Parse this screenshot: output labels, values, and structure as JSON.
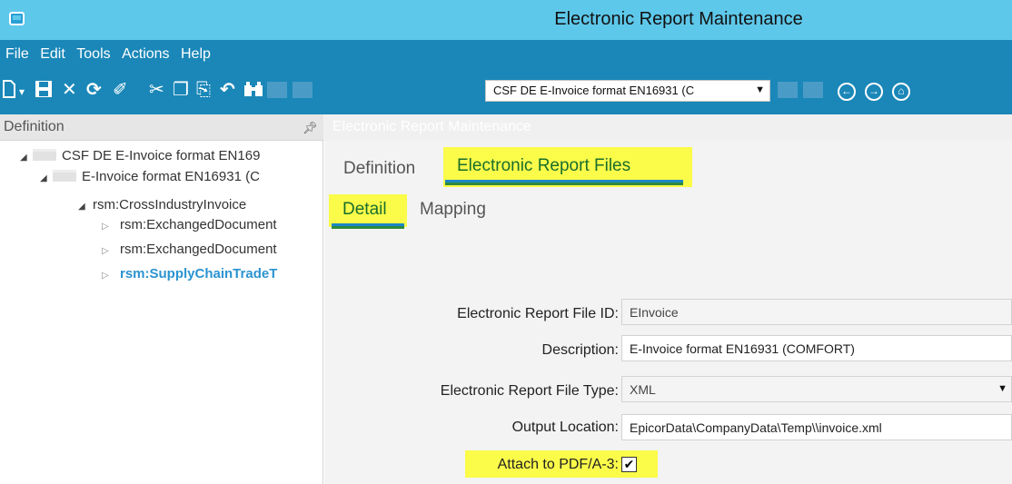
{
  "window": {
    "title": "Electronic Report Maintenance"
  },
  "menu": {
    "items": [
      "File",
      "Edit",
      "Tools",
      "Actions",
      "Help"
    ]
  },
  "toolbar": {
    "record_selector": "CSF DE E-Invoice format EN16931 (C"
  },
  "left_panel": {
    "title": "Definition",
    "tree": [
      {
        "label": "CSF DE E-Invoice format EN169",
        "level": 0,
        "expanded": true,
        "folder": true
      },
      {
        "label": "E-Invoice format EN16931 (C",
        "level": 1,
        "expanded": true,
        "folder": true
      },
      {
        "label": "rsm:CrossIndustryInvoice",
        "level": 2,
        "expanded": true,
        "folder": false
      },
      {
        "label": "rsm:ExchangedDocument",
        "level": 3,
        "expanded": false,
        "folder": false
      },
      {
        "label": "rsm:ExchangedDocument",
        "level": 3,
        "expanded": false,
        "folder": false
      },
      {
        "label": "rsm:SupplyChainTradeT",
        "level": 3,
        "expanded": false,
        "folder": false,
        "selected": true
      }
    ]
  },
  "right_panel": {
    "title": "Electronic Report Maintenance",
    "tabs": [
      {
        "label": "Definition",
        "active": false
      },
      {
        "label": "Electronic Report Files",
        "active": true
      }
    ],
    "subtabs": [
      {
        "label": "Detail",
        "active": true
      },
      {
        "label": "Mapping",
        "active": false
      }
    ],
    "form": {
      "file_id": {
        "label": "Electronic Report File ID:",
        "value": "EInvoice"
      },
      "description": {
        "label": "Description:",
        "value": "E-Invoice format EN16931 (COMFORT)"
      },
      "file_type": {
        "label": "Electronic Report File Type:",
        "value": "XML"
      },
      "output_location": {
        "label": "Output Location:",
        "value": "EpicorData\\CompanyData\\Temp\\\\invoice.xml"
      },
      "attach_pdf": {
        "label": "Attach to PDF/A-3:",
        "checked": true
      }
    }
  },
  "colors": {
    "title_bar": "#5ec8ea",
    "toolbar": "#1a87b8",
    "highlight": "#fbfb4a",
    "selected_tree": "#2b93d0"
  }
}
